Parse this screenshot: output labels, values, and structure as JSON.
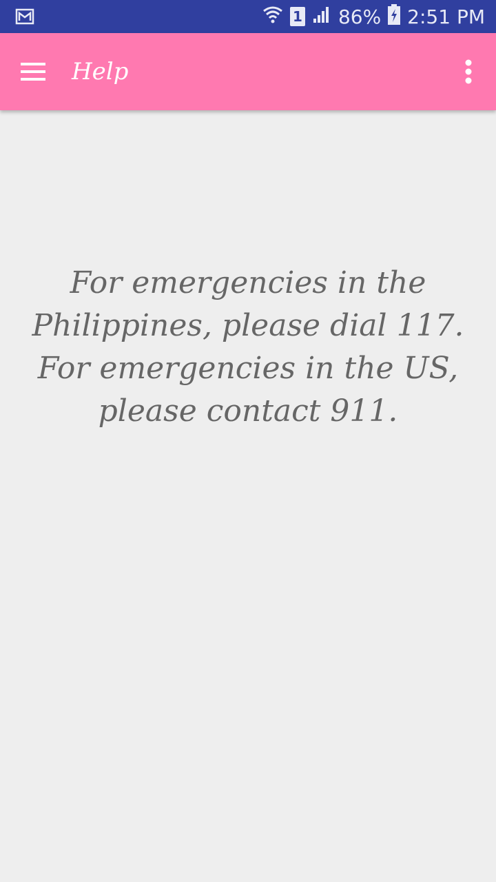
{
  "status_bar": {
    "sim_slot": "1",
    "battery": "86%",
    "time": "2:51 PM"
  },
  "app_bar": {
    "title": "Help"
  },
  "help": {
    "line1": "For emergencies in the Philippines, please dial 117.",
    "line2": "For emergencies in the US, please contact 911."
  },
  "colors": {
    "status_bar": "#303f9f",
    "app_bar": "#ff79b0",
    "background": "#eeeeee",
    "text": "#666666"
  }
}
